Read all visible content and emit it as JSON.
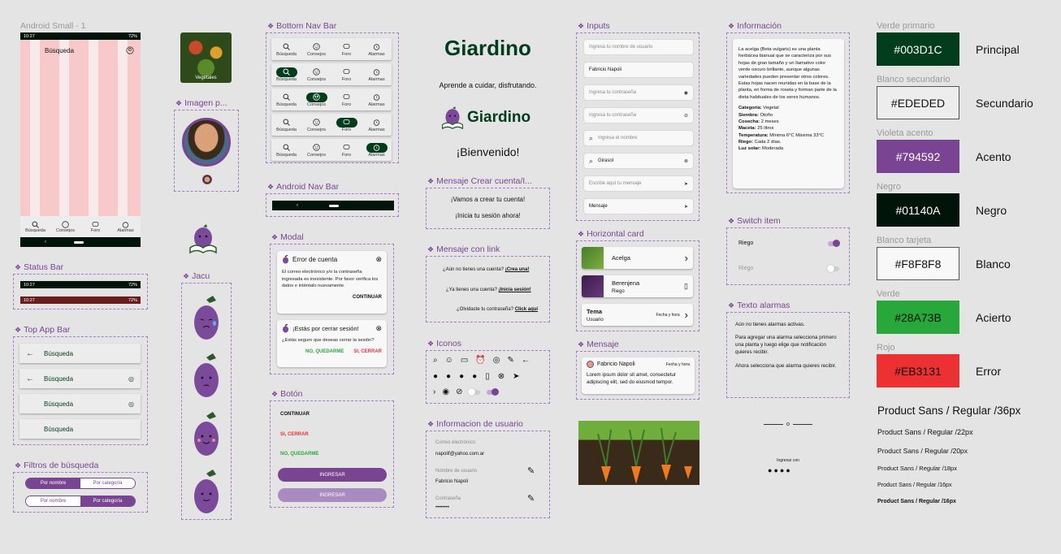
{
  "android_small": {
    "title": "Android Small - 1",
    "status_time": "10:27",
    "status_pct": "72%",
    "app_title": "Búsqueda",
    "nav": [
      "Búsqueda",
      "Consejos",
      "Foro",
      "Alarmas"
    ]
  },
  "vegetales": {
    "label": "Vegetales"
  },
  "sections": {
    "status_bar": "Status Bar",
    "top_app_bar": "Top App Bar",
    "filtros": "Filtros de búsqueda",
    "imagen": "Imagen p...",
    "jacu": "Jacu",
    "bottom_nav": "Bottom Nav Bar",
    "android_nav": "Android Nav Bar",
    "modal": "Modal",
    "boton": "Botón",
    "mensaje_crear": "Mensaje Crear cuenta/I...",
    "mensaje_link": "Mensaje con link",
    "iconos": "Iconos",
    "info_usuario": "Informacion de usuario",
    "inputs": "Inputs",
    "horizontal_card": "Horizontal card",
    "mensaje": "Mensaje",
    "informacion": "Información",
    "switch_item": "Switch item",
    "texto_alarmas": "Texto alarmas"
  },
  "status": {
    "time": "10:27",
    "pct": "72%"
  },
  "top_app_bar": {
    "title": "Búsqueda"
  },
  "filtros": {
    "a": "Por nombre",
    "b": "Por categoría"
  },
  "bottom_nav": {
    "items": [
      "Búsqueda",
      "Consejos",
      "Foro",
      "Alarmas"
    ]
  },
  "brand": {
    "logo": "Giardino",
    "tagline": "Aprende a cuidar, disfrutando.",
    "logo2": "Giardino",
    "welcome": "¡Bienvenido!"
  },
  "modal": {
    "title1": "Error de cuenta",
    "body1": "El correo electrónico y/o la contraseña ingresada es inexistente. Por favor verifica los datos e inténtalo nuevamente.",
    "btn1": "CONTINUAR",
    "title2": "¡Estás por cerrar sesión!",
    "body2": "¿Estás seguro que deseas cerrar la sesión?",
    "no": "NO, QUEDARME",
    "si": "SI, CERRAR"
  },
  "boton": {
    "continuar": "CONTINUAR",
    "si": "SI, CERRAR",
    "no": "NO, QUEDARME",
    "ingresar1": "INGRESAR",
    "ingresar2": "INGRESAR"
  },
  "mensaje_crear": {
    "l1": "¡Vamos a crear tu cuenta!",
    "l2": "¡Inicia tu sesión ahora!"
  },
  "mensaje_link": {
    "q1": "¿Aún no tienes una cuenta?",
    "a1": "¡Crea una!",
    "q2": "¿Ya tienes una cuenta?",
    "a2": "¡Inicia sesión!",
    "q3": "¿Olvidaste tu contraseña?",
    "a3": "Click aquí"
  },
  "info_usuario": {
    "email_label": "Correo electrónico",
    "email": "napolif@yahoo.com.ar",
    "name_label": "Nombre de usuario",
    "name": "Fabricio Napoli",
    "pass_label": "Contraseña",
    "pass": "••••••••"
  },
  "inputs": {
    "i1": "Ingresa tu nombre de usuario",
    "i2": "Fabricio Napoli",
    "i3": "Ingresa tu contraseña",
    "i4": "Ingresa tu contraseña",
    "i5": "Ingresa el nombre",
    "i6": "Girasol",
    "i7": "Escribe aquí tu mensaje",
    "i8": "Mensaje"
  },
  "hcard": {
    "c1": "Acelga",
    "c2": "Berenjena",
    "c2sub": "Riego",
    "c3": "Tema",
    "c3sub": "Usuario",
    "c3date": "Fecha y hora"
  },
  "mensaje": {
    "name": "Fabricio Napoli",
    "date": "Fecha y hora",
    "body": "Lorem ipsum dolor sit amet, consectetur adipiscing elit, sed do eiusmod tempor."
  },
  "informacion": {
    "body": "La acelga (Beta vulgaris) es una planta herbácea bianual que se caracteriza por sus hojas de gran tamaño y un llamativo color verde oscuro brillante, aunque algunas variedades pueden presentar otros colores. Estas hojas nacen reunidas en la base de la planta, en forma de roseta y forman parte de la dieta habituales de los seres humanos.",
    "rows": [
      {
        "k": "Categoría:",
        "v": "Vegetal"
      },
      {
        "k": "Siembra:",
        "v": "Otoño"
      },
      {
        "k": "Cosecha:",
        "v": "2 meses"
      },
      {
        "k": "Maceta:",
        "v": "25 litros"
      },
      {
        "k": "Temperatura:",
        "v": "Mínima 6°C Máxima 33°C"
      },
      {
        "k": "Riego:",
        "v": "Cada 2 días."
      },
      {
        "k": "Luz solar:",
        "v": "Moderada"
      }
    ]
  },
  "switch_item": {
    "s1": "Riego",
    "s2": "Riego"
  },
  "texto_alarmas": {
    "p1": "Aún no tienes alarmas activas.",
    "p2": "Para agregar una alarma selecciona primero una planta y luego elige que notificación quieres recibir.",
    "p3": "Ahora selecciona que alarma quieres recibir."
  },
  "divider": {
    "o": "o",
    "login_with": "Ingresar con"
  },
  "colors": [
    {
      "label": "Verde primario",
      "hex": "#003D1C",
      "name": "Principal",
      "fg": "#ffffff"
    },
    {
      "label": "Blanco secundario",
      "hex": "#EDEDED",
      "name": "Secundario",
      "fg": "#111111"
    },
    {
      "label": "Violeta acento",
      "hex": "#794592",
      "name": "Acento",
      "fg": "#ffffff"
    },
    {
      "label": "Negro",
      "hex": "#01140A",
      "name": "Negro",
      "fg": "#ffffff"
    },
    {
      "label": "Blanco tarjeta",
      "hex": "#F8F8F8",
      "name": "Blanco",
      "fg": "#111111"
    },
    {
      "label": "Verde",
      "hex": "#28A73B",
      "name": "Acierto",
      "fg": "#111111"
    },
    {
      "label": "Rojo",
      "hex": "#EB3131",
      "name": "Error",
      "fg": "#111111"
    }
  ],
  "typography": [
    "Product Sans / Regular /36px",
    "Product Sans / Regular /22px",
    "Product Sans / Regular /20px",
    "Product Sans / Regular /18px",
    "Product Sans / Regular /16px",
    "Product Sans / Regular /16px"
  ]
}
